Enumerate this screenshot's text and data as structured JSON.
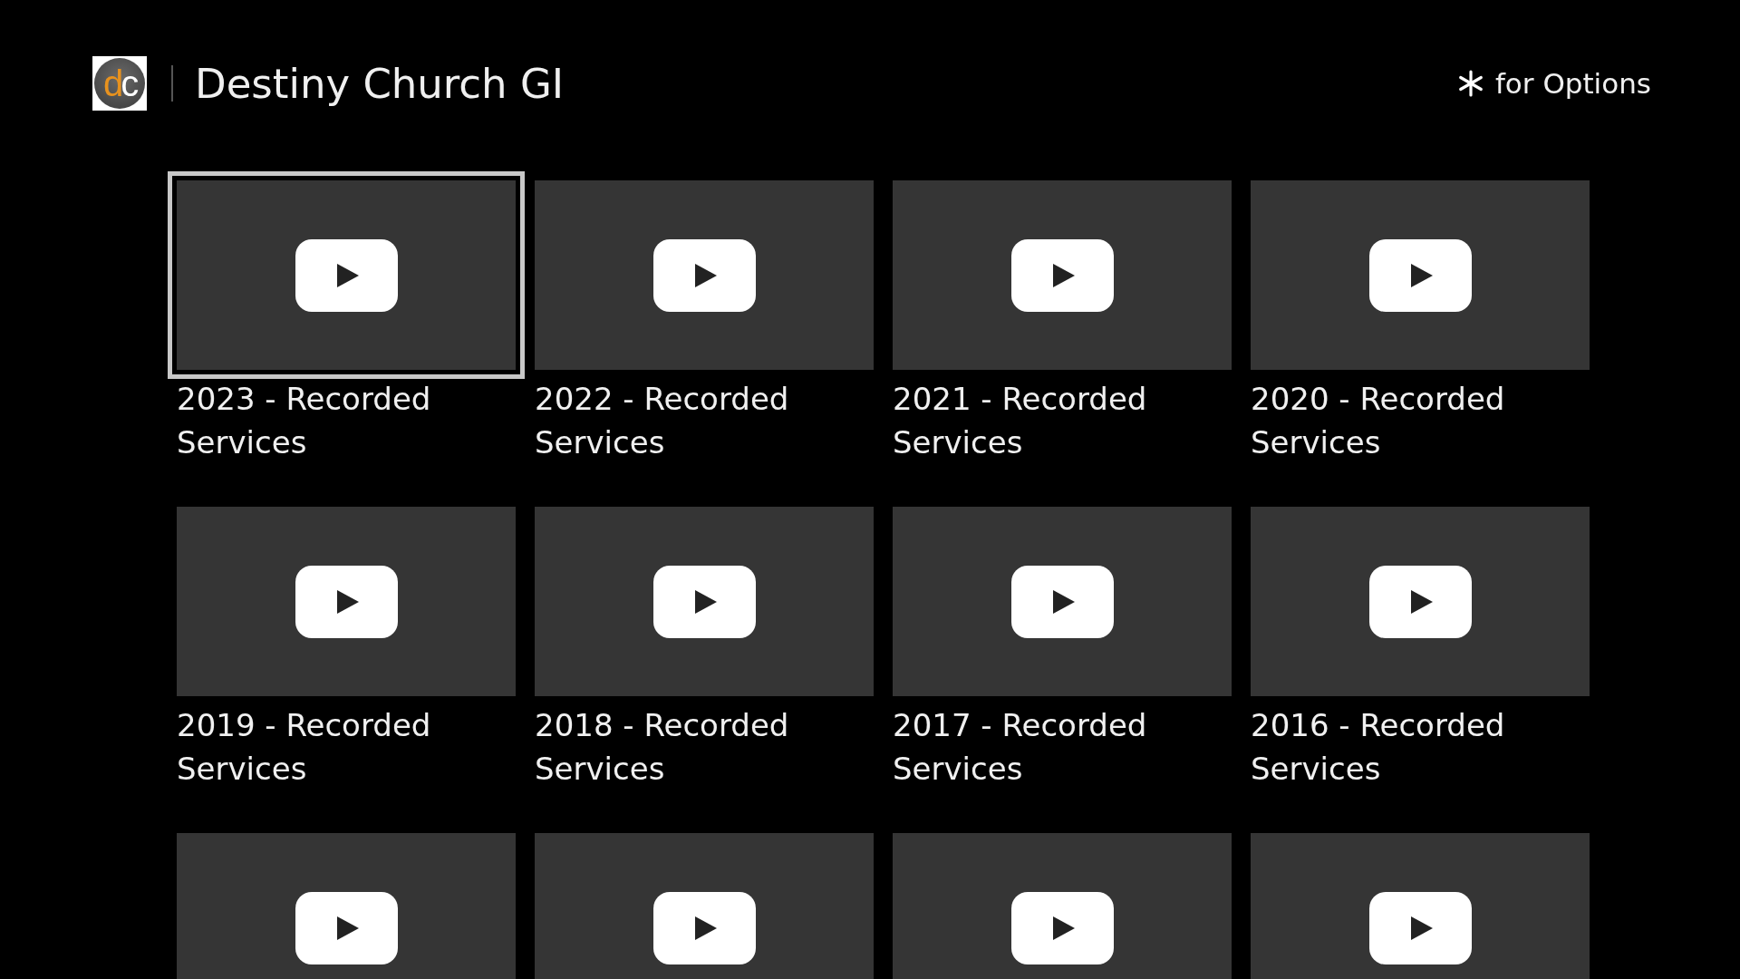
{
  "header": {
    "logo": {
      "letters": [
        "d",
        "c"
      ]
    },
    "title": "Destiny Church GI",
    "hint": "for Options"
  },
  "grid": {
    "items": [
      {
        "title": "2023 - Recorded Services",
        "selected": true
      },
      {
        "title": "2022 - Recorded Services",
        "selected": false
      },
      {
        "title": "2021 - Recorded Services",
        "selected": false
      },
      {
        "title": "2020 - Recorded Services",
        "selected": false
      },
      {
        "title": "2019 - Recorded Services",
        "selected": false
      },
      {
        "title": "2018 - Recorded Services",
        "selected": false
      },
      {
        "title": "2017 - Recorded Services",
        "selected": false
      },
      {
        "title": "2016 - Recorded Services",
        "selected": false
      },
      {
        "selected": false
      },
      {
        "selected": false
      },
      {
        "selected": false
      },
      {
        "selected": false
      }
    ]
  }
}
